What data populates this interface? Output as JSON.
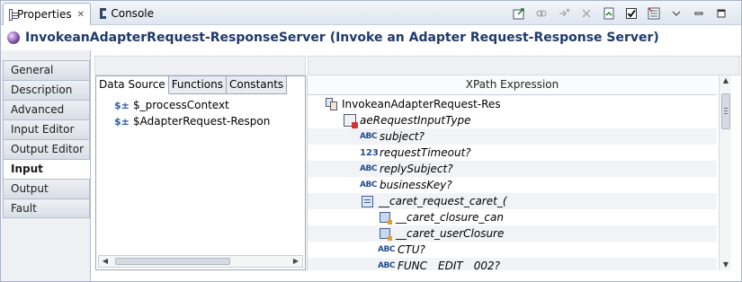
{
  "tabs": {
    "properties": "Properties",
    "properties_close": "✕",
    "console": "Console"
  },
  "toolbar": {
    "icons": [
      "pin-editor-icon",
      "link-icon",
      "remove-icon",
      "remove-all-icon",
      "new-view-icon",
      "checkbox-icon",
      "filter-icon",
      "view-menu-icon",
      "minimize-icon",
      "maximize-icon"
    ]
  },
  "title": "InvokeanAdapterRequest-ResponseServer (Invoke an Adapter Request-Response Server)",
  "sections": [
    "General",
    "Description",
    "Advanced",
    "Input Editor",
    "Output Editor",
    "Input",
    "Output",
    "Fault"
  ],
  "selected_section": "Input",
  "data_source": {
    "tabs": [
      "Data Source",
      "Functions",
      "Constants"
    ],
    "items": [
      "$_processContext",
      "$AdapterRequest-Respon"
    ]
  },
  "xpath": {
    "header": "XPath Expression",
    "tree": [
      {
        "label": "InvokeanAdapterRequest-Res",
        "icon": "process-data-icon"
      },
      {
        "label": "aeRequestInputType",
        "icon": "element-icon"
      },
      {
        "label": "subject?",
        "icon": "string-icon",
        "type_text": "ABC"
      },
      {
        "label": "requestTimeout?",
        "icon": "number-icon",
        "type_text": "123"
      },
      {
        "label": "replySubject?",
        "icon": "string-icon",
        "type_text": "ABC"
      },
      {
        "label": "businessKey?",
        "icon": "string-icon",
        "type_text": "ABC"
      },
      {
        "label": "__caret_request_caret_(",
        "icon": "complex-icon"
      },
      {
        "label": "__caret_closure_can",
        "icon": "attribute-icon"
      },
      {
        "label": "__caret_userClosure",
        "icon": "attribute-icon"
      },
      {
        "label": "CTU?",
        "icon": "string-icon",
        "type_text": "ABC"
      },
      {
        "label": "FUNC__EDIT__002?",
        "icon": "string-icon",
        "type_text": "ABC"
      }
    ]
  },
  "colors": {
    "title": "#1f3a6b",
    "type_icon": "#234d8c",
    "badge_red": "#d9322b"
  }
}
